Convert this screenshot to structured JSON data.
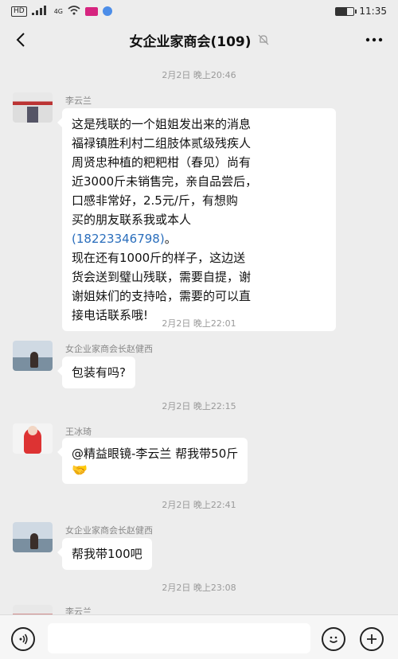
{
  "status_bar": {
    "network": "HD",
    "signal": "4G",
    "time": "11:35"
  },
  "nav": {
    "title": "女企业家商会(109)"
  },
  "messages": [
    {
      "timestamp": "2月2日 晚上20:46",
      "sender": "李云兰",
      "lines": [
        "这是残联的一个姐姐发出来的消息",
        "福禄镇胜利村二组肢体贰级残疾人",
        "周贤忠种植的粑粑柑（春见）尚有",
        "近3000斤未销售完，亲自品尝后，",
        "口感非常好，2.5元/斤，有想购",
        "买的朋友联系我或本人"
      ],
      "phone": "(18223346798)",
      "phone_suffix": "。",
      "lines2": [
        "现在还有1000斤的样子，这边送",
        "货会送到璧山残联，需要自提，谢",
        "谢姐妹们的支持哈，需要的可以直",
        "接电话联系哦!"
      ]
    },
    {
      "timestamp": "2月2日 晚上22:01",
      "sender": "女企业家商会长赵健西",
      "text": "包装有吗?"
    },
    {
      "timestamp": "2月2日 晚上22:15",
      "sender": "王冰琦",
      "text": "@精益眼镜-李云兰  帮我带50斤",
      "emoji": "🤝"
    },
    {
      "timestamp": "2月2日 晚上22:41",
      "sender": "女企业家商会长赵健西",
      "text": "帮我带100吧"
    },
    {
      "timestamp": "2月2日 晚上23:08",
      "sender": "李云兰"
    }
  ],
  "colors": {
    "background": "#ededed",
    "bubble": "#ffffff",
    "link": "#2a6ebc",
    "timestamp": "#9a9a9a"
  }
}
